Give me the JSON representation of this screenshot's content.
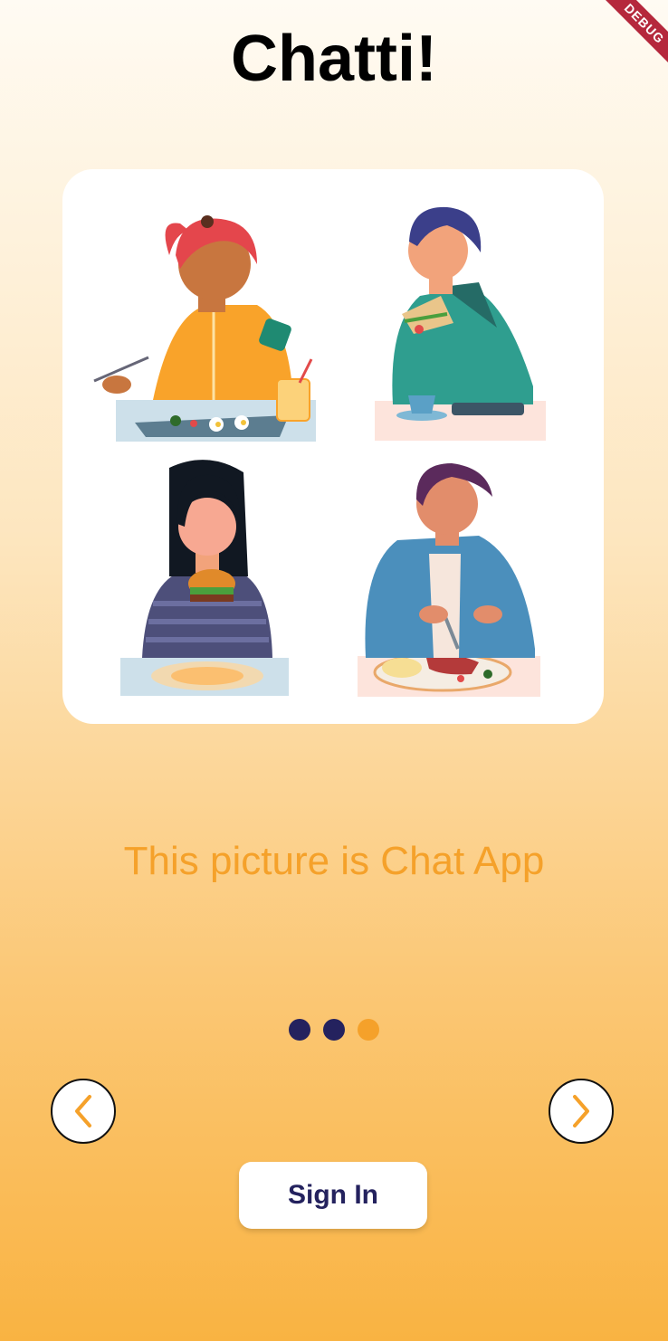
{
  "app": {
    "title": "Chatti!",
    "debug_banner": "DEBUG"
  },
  "slide": {
    "caption": "This picture is Chat App",
    "illustration": "four-people-eating-illustration"
  },
  "pager": {
    "total": 3,
    "current_index": 2,
    "active_color": "#f5a12a",
    "inactive_color": "#24225e"
  },
  "nav": {
    "prev_icon": "chevron-left-icon",
    "next_icon": "chevron-right-icon",
    "icon_color": "#f5a12a"
  },
  "actions": {
    "sign_in_label": "Sign In"
  },
  "colors": {
    "title": "#000000",
    "caption": "#f5a12a",
    "button_text": "#24225e"
  }
}
